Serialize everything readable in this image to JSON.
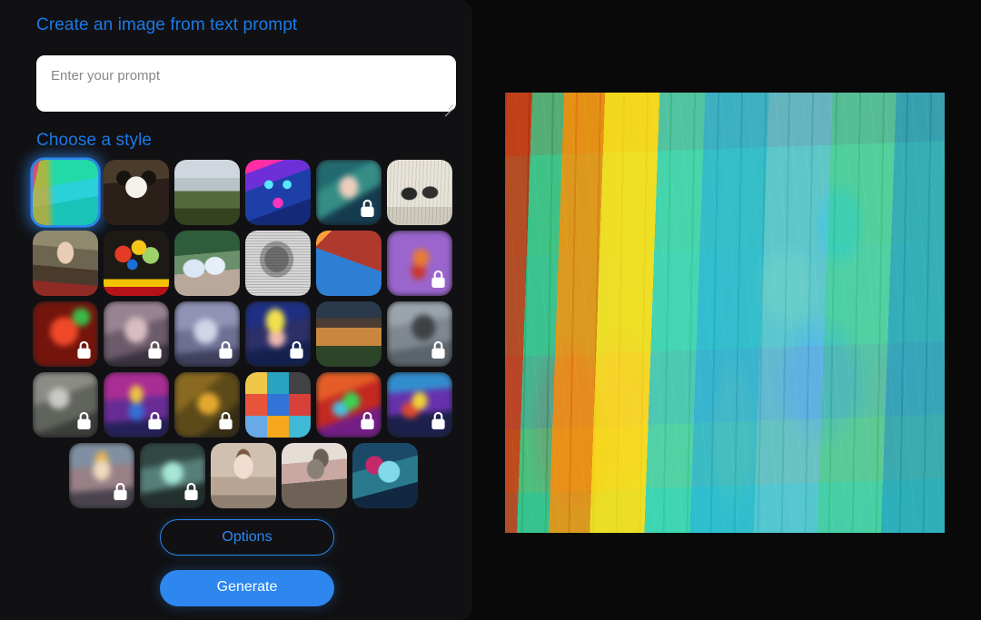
{
  "app": {
    "accent_color": "#2d87ef",
    "background_color": "#09090a",
    "panel_color": "#111113"
  },
  "headings": {
    "create": "Create an image from text prompt",
    "choose_style": "Choose a style"
  },
  "prompt": {
    "value": "",
    "placeholder": "Enter your prompt"
  },
  "buttons": {
    "options_label": "Options",
    "generate_label": "Generate"
  },
  "style_grid": {
    "selected_index": 0,
    "lock_icon": "lock-icon",
    "rows": [
      [
        {
          "name": "style-abstract-jungle",
          "art": "a-sel",
          "selected": true,
          "locked": false
        },
        {
          "name": "style-panda",
          "art": "a-panda",
          "selected": false,
          "locked": false
        },
        {
          "name": "style-misty-forest",
          "art": "a-forest",
          "selected": false,
          "locked": false
        },
        {
          "name": "style-neon-robot",
          "art": "a-robot",
          "selected": false,
          "locked": false
        },
        {
          "name": "style-anime-portrait",
          "art": "a-anime",
          "selected": false,
          "locked": true
        },
        {
          "name": "style-engraving",
          "art": "a-engrave",
          "selected": false,
          "locked": false
        }
      ],
      [
        {
          "name": "style-renaissance",
          "art": "a-renaissance",
          "selected": false,
          "locked": false
        },
        {
          "name": "style-flower-vase",
          "art": "a-flowers",
          "selected": false,
          "locked": false
        },
        {
          "name": "style-ballet",
          "art": "a-ballet",
          "selected": false,
          "locked": false
        },
        {
          "name": "style-etching-cup",
          "art": "a-etch",
          "selected": false,
          "locked": false
        },
        {
          "name": "style-isometric",
          "art": "a-iso",
          "selected": false,
          "locked": false
        },
        {
          "name": "style-fox",
          "art": "a-fox",
          "selected": false,
          "locked": true
        }
      ],
      [
        {
          "name": "style-red-face",
          "art": "a-redface",
          "selected": false,
          "locked": true
        },
        {
          "name": "style-soft-portrait",
          "art": "a-portrait1",
          "selected": false,
          "locked": true
        },
        {
          "name": "style-pastel-portrait",
          "art": "a-portrait2",
          "selected": false,
          "locked": true
        },
        {
          "name": "style-pop-art",
          "art": "a-popart",
          "selected": false,
          "locked": true
        },
        {
          "name": "style-architecture",
          "art": "a-arch",
          "selected": false,
          "locked": false
        },
        {
          "name": "style-smoke",
          "art": "a-smoke",
          "selected": false,
          "locked": true
        }
      ],
      [
        {
          "name": "style-grey-abstract",
          "art": "a-abstract1",
          "selected": false,
          "locked": true
        },
        {
          "name": "style-neon-figure",
          "art": "a-neonfig",
          "selected": false,
          "locked": true
        },
        {
          "name": "style-gold-swirl",
          "art": "a-goldswirl",
          "selected": false,
          "locked": true
        },
        {
          "name": "style-icon-set",
          "art": "a-icons",
          "selected": false,
          "locked": false
        },
        {
          "name": "style-neon-swirl",
          "art": "a-neonswirl",
          "selected": false,
          "locked": true
        },
        {
          "name": "style-psychedelic",
          "art": "a-psyche",
          "selected": false,
          "locked": true
        }
      ],
      [
        {
          "name": "style-fairy",
          "art": "a-fairy",
          "selected": false,
          "locked": true
        },
        {
          "name": "style-ghostly",
          "art": "a-ghost",
          "selected": false,
          "locked": true
        },
        {
          "name": "style-porcelain-doll",
          "art": "a-doll",
          "selected": false,
          "locked": false
        },
        {
          "name": "style-oil-painter",
          "art": "a-painter",
          "selected": false,
          "locked": false
        },
        {
          "name": "style-cyber-portrait",
          "art": "a-cyber",
          "selected": false,
          "locked": false
        }
      ]
    ]
  },
  "result": {
    "name": "generated-image",
    "alt": "Abstract colorful painting of figures among vertical streaks"
  }
}
